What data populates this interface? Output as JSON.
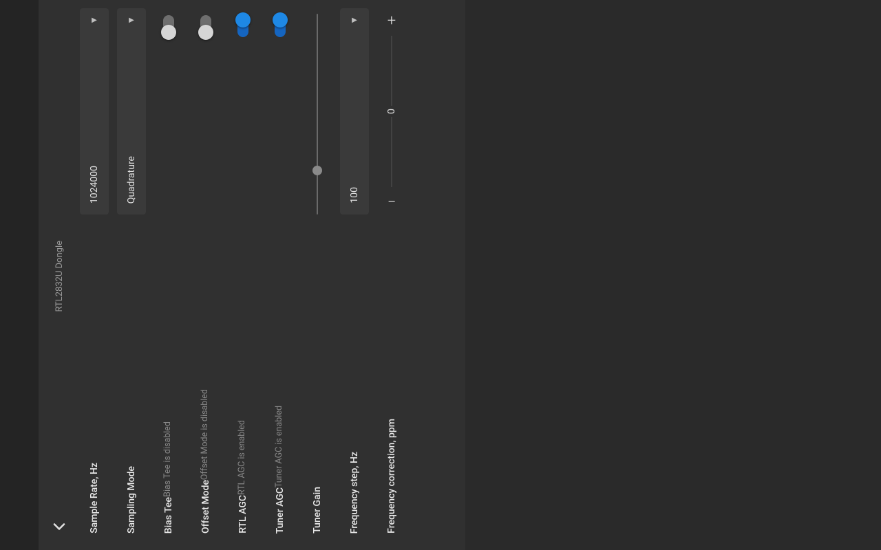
{
  "header": {
    "title": "RTL2832U Dongle"
  },
  "settings": {
    "sample_rate": {
      "label": "Sample Rate, Hz",
      "value": "1024000"
    },
    "sampling_mode": {
      "label": "Sampling Mode",
      "value": "Quadrature"
    },
    "bias_tee": {
      "label": "Bias Tee",
      "status": "Bias Tee is disabled",
      "on": false
    },
    "offset_mode": {
      "label": "Offset Mode",
      "status": "Offset Mode is disabled",
      "on": false
    },
    "rtl_agc": {
      "label": "RTL AGC",
      "status": "RTL AGC is enabled",
      "on": true
    },
    "tuner_agc": {
      "label": "Tuner AGC",
      "status": "Tuner AGC is enabled",
      "on": true
    },
    "tuner_gain": {
      "label": "Tuner Gain",
      "percent": 18
    },
    "freq_step": {
      "label": "Frequency step, Hz",
      "value": "100"
    },
    "freq_corr": {
      "label": "Frequency correction, ppm",
      "value": "0"
    }
  }
}
